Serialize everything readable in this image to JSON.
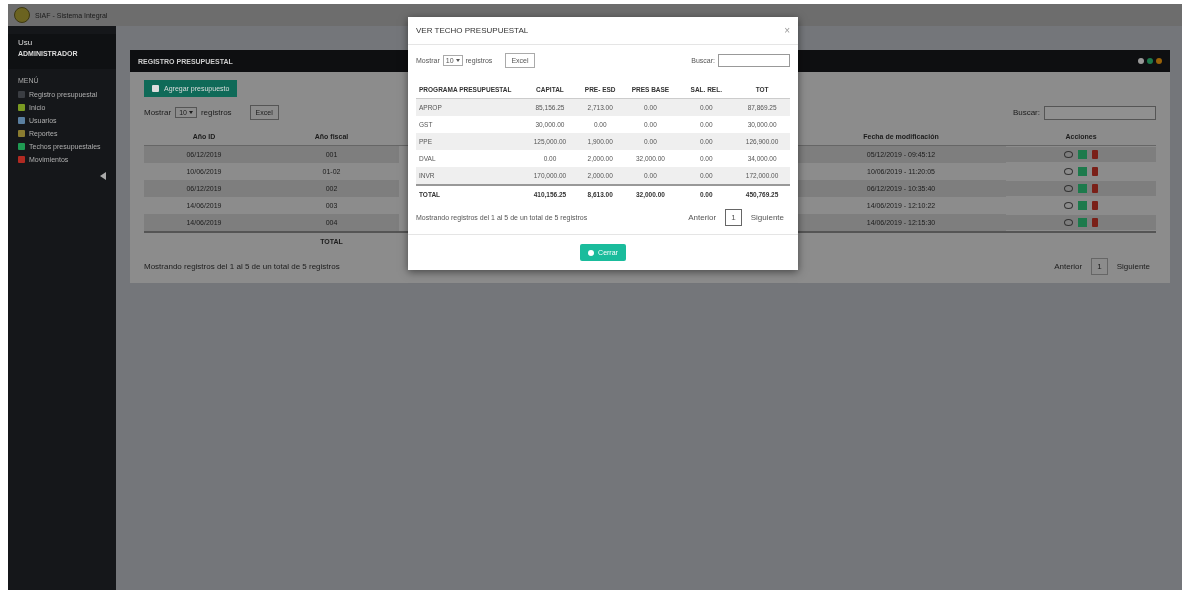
{
  "header": {
    "title": "SIAF - Sistema Integral"
  },
  "sidebar": {
    "user_role": "Usu",
    "user_name": "ADMINISTRADOR",
    "section": "MENÚ",
    "items": [
      {
        "label": "Registro presupuestal",
        "color": "#3a3d42"
      },
      {
        "label": "Inicio",
        "color": "#7a9a22"
      },
      {
        "label": "Usuarios",
        "color": "#5a7fa0"
      },
      {
        "label": "Reportes",
        "color": "#8a7c30"
      },
      {
        "label": "Techos presupuestales",
        "color": "#1f9a52"
      },
      {
        "label": "Movimientos",
        "color": "#b02a22"
      }
    ]
  },
  "panel": {
    "title": "REGISTRO PRESUPUESTAL",
    "add_button": "Agregar presupuesto",
    "length_label_before": "Mostrar",
    "length_value": "10",
    "length_label_after": "registros",
    "export_button": "Excel",
    "search_label": "Buscar:",
    "table": {
      "columns": [
        "Año ID",
        "Año fiscal",
        "",
        "Fecha de modificación",
        "Acciones"
      ],
      "rows": [
        [
          "06/12/2019",
          "001",
          "",
          "05/12/2019 - 09:45:12"
        ],
        [
          "10/06/2019",
          "01-02",
          "",
          "10/06/2019 - 11:20:05"
        ],
        [
          "06/12/2019",
          "002",
          "",
          "06/12/2019 - 10:35:40"
        ],
        [
          "14/06/2019",
          "003",
          "",
          "14/06/2019 - 12:10:22"
        ],
        [
          "14/06/2019",
          "004",
          "",
          "14/06/2019 - 12:15:30"
        ]
      ],
      "footer": "TOTAL"
    },
    "info": "Mostrando registros del 1 al 5 de un total de 5 registros",
    "pages": [
      {
        "label": "Anterior",
        "selected": false
      },
      {
        "label": "1",
        "selected": true
      },
      {
        "label": "Siguiente",
        "selected": false
      }
    ]
  },
  "modal": {
    "title": "VER TECHO PRESUPUESTAL",
    "close": "×",
    "length_label_before": "Mostrar",
    "length_value": "10",
    "length_label_after": "registros",
    "export_button": "Excel",
    "search_label": "Buscar:",
    "table": {
      "columns": [
        "PROGRAMA PRESUPUESTAL",
        "CAPITAL",
        "PRE- ESD",
        "PRES BASE",
        "SAL. REL.",
        "TOT"
      ],
      "rows": [
        [
          "APROP",
          "85,156.25",
          "2,713.00",
          "0.00",
          "0.00",
          "87,869.25"
        ],
        [
          "GST",
          "30,000.00",
          "0.00",
          "0.00",
          "0.00",
          "30,000.00"
        ],
        [
          "PPE",
          "125,000.00",
          "1,900.00",
          "0.00",
          "0.00",
          "126,900.00"
        ],
        [
          "DVAL",
          "0.00",
          "2,000.00",
          "32,000.00",
          "0.00",
          "34,000.00"
        ],
        [
          "INVR",
          "170,000.00",
          "2,000.00",
          "0.00",
          "0.00",
          "172,000.00"
        ]
      ],
      "footer": [
        "TOTAL",
        "410,156.25",
        "8,613.00",
        "32,000.00",
        "0.00",
        "450,769.25"
      ]
    },
    "info": "Mostrando registros del 1 al 5 de un total de 5 registros",
    "pages": [
      {
        "label": "Anterior",
        "selected": false
      },
      {
        "label": "1",
        "selected": true
      },
      {
        "label": "Siguiente",
        "selected": false
      }
    ],
    "close_button": "Cerrar"
  }
}
